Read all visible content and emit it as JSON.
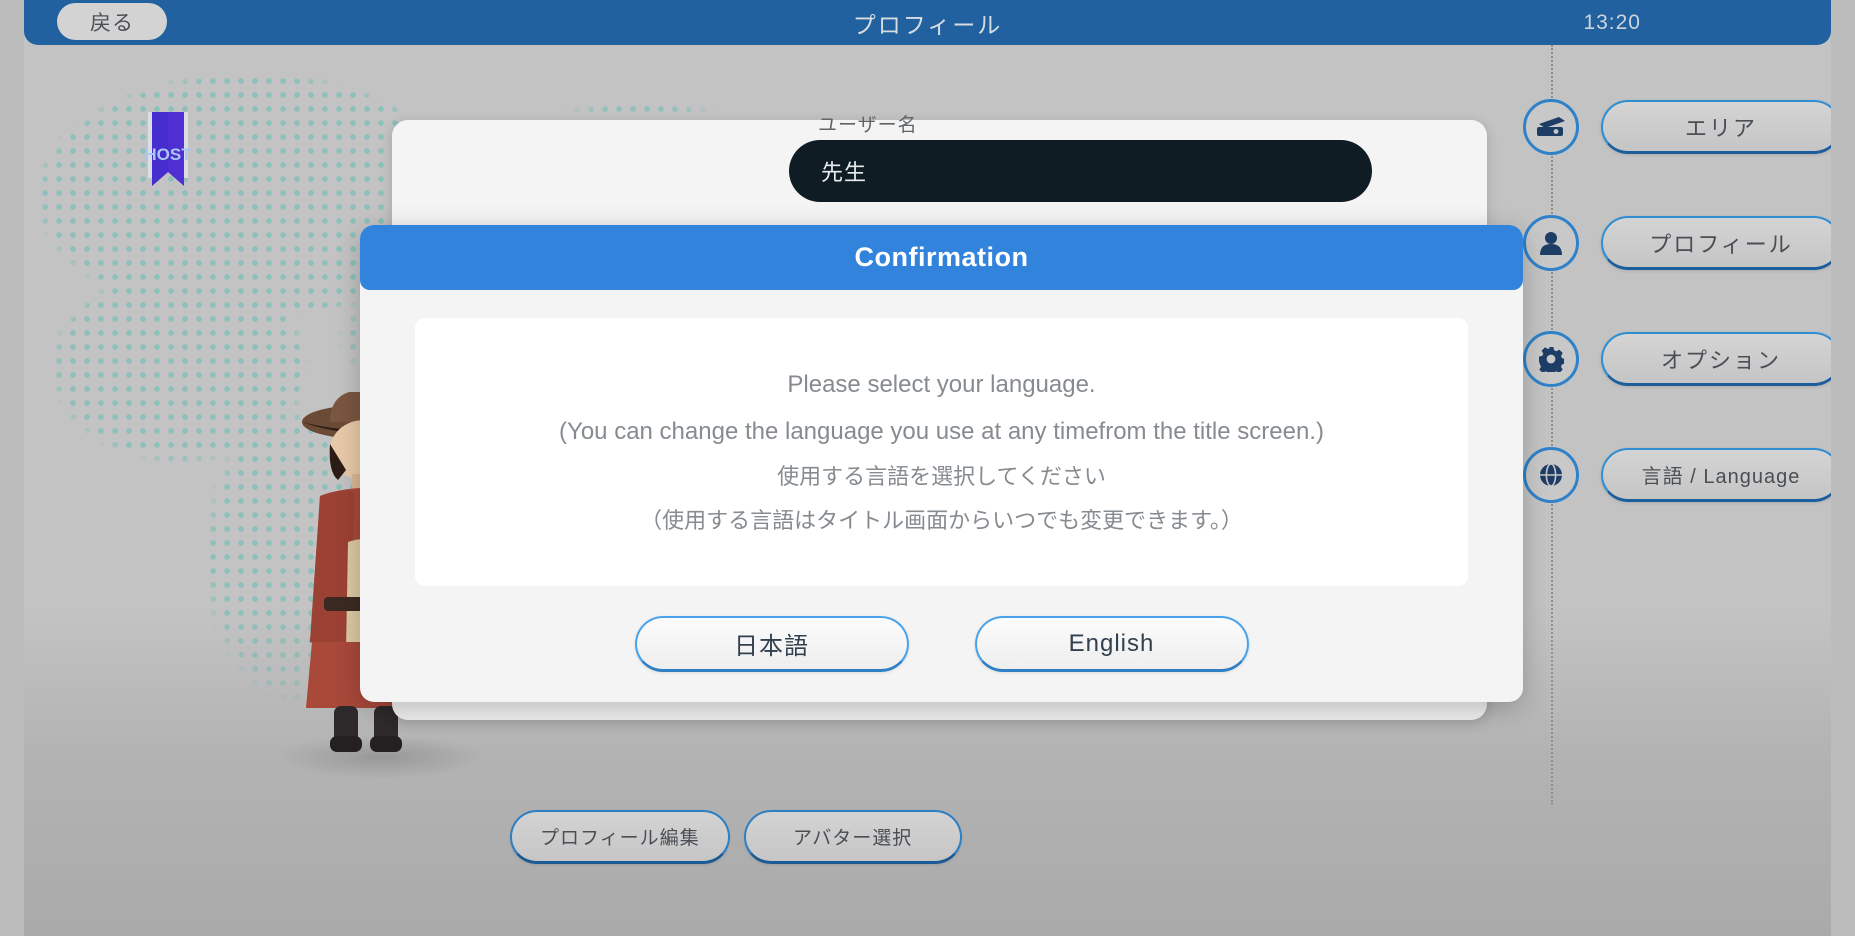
{
  "topbar": {
    "back_label": "戻る",
    "title": "プロフィール",
    "clock": "13:20",
    "bg_color": "#21619f"
  },
  "profile": {
    "badge_text": "HOST",
    "username_label": "ユーザー名",
    "username_value": "先生",
    "actions": [
      {
        "label": "プロフィール編集",
        "name": "edit-profile-button"
      },
      {
        "label": "アバター選択",
        "name": "select-avatar-button"
      }
    ]
  },
  "rail": {
    "items": [
      {
        "label": "エリア",
        "icon": "ticket-icon"
      },
      {
        "label": "プロフィール",
        "icon": "person-icon"
      },
      {
        "label": "オプション",
        "icon": "gear-icon"
      },
      {
        "label": "言語 / Language",
        "icon": "globe-icon"
      }
    ]
  },
  "dialog": {
    "title": "Confirmation",
    "lines": [
      "Please select your language.",
      "(You can change the language you use at any timefrom the title screen.)",
      "使用する言語を選択してください",
      "（使用する言語はタイトル画面からいつでも変更できます。）"
    ],
    "buttons": [
      {
        "label": "日本語",
        "name": "japanese-button"
      },
      {
        "label": "English",
        "name": "english-button"
      }
    ],
    "header_color": "#3183db"
  }
}
